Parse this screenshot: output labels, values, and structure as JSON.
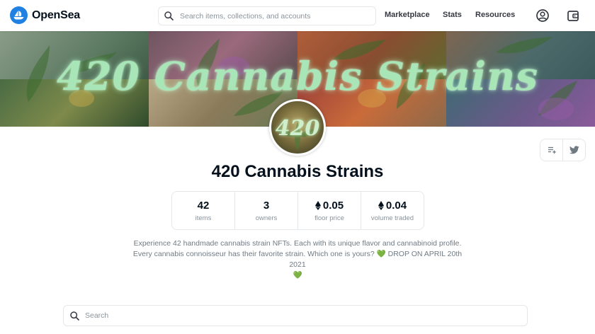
{
  "header": {
    "brand": "OpenSea",
    "search_placeholder": "Search items, collections, and accounts",
    "nav": [
      "Marketplace",
      "Stats",
      "Resources"
    ]
  },
  "banner": {
    "title": "420 Cannabis Strains"
  },
  "avatar": {
    "text": "420"
  },
  "collection": {
    "title": "420 Cannabis Strains",
    "stats": [
      {
        "value": "42",
        "label": "items",
        "eth": false
      },
      {
        "value": "3",
        "label": "owners",
        "eth": false
      },
      {
        "value": "0.05",
        "label": "floor price",
        "eth": true
      },
      {
        "value": "0.04",
        "label": "volume traded",
        "eth": true
      }
    ],
    "description_line1": "Experience 42 handmade cannabis strain NFTs. Each with its unique flavor and cannabinoid profile.",
    "description_line2": "Every cannabis connoisseur has their favorite strain. Which one is yours?",
    "description_drop": "DROP ON APRIL 20th 2021",
    "heart": "💚"
  },
  "items_search": {
    "placeholder": "Search"
  },
  "colors": {
    "brand": "#2081e2",
    "text": "#04111d",
    "muted": "#8a939b",
    "border": "#e5e8eb",
    "title_glow": "#a8e6b8"
  },
  "icons": [
    "opensea-logo-icon",
    "search-icon",
    "account-icon",
    "wallet-icon",
    "add-to-watchlist-icon",
    "twitter-icon",
    "ethereum-icon",
    "green-heart-icon"
  ]
}
